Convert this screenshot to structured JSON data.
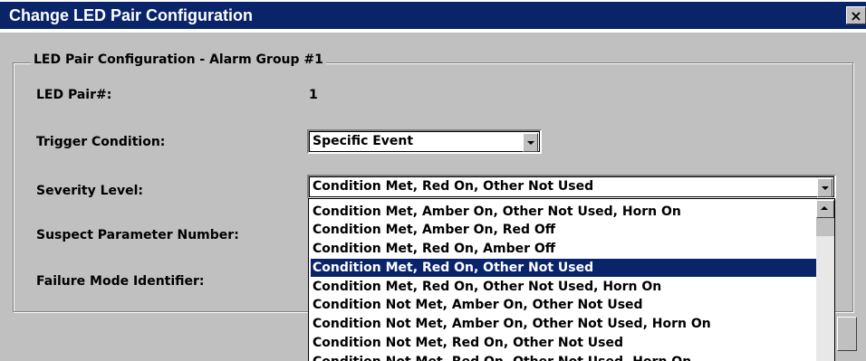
{
  "window": {
    "title": "Change LED Pair Configuration",
    "close_label": "×"
  },
  "group": {
    "title": "LED Pair Configuration - Alarm Group #1"
  },
  "fields": {
    "led_pair_label": "LED Pair#:",
    "led_pair_value": "1",
    "trigger_label": "Trigger Condition:",
    "trigger_value": "Specific Event",
    "severity_label": "Severity Level:",
    "severity_value": "Condition Met, Red On, Other Not Used",
    "spn_label": "Suspect Parameter Number:",
    "fmi_label": "Failure Mode Identifier:"
  },
  "severity_options": [
    "Condition Met, Amber On, Other Not Used, Horn On",
    "Condition Met, Amber On, Red Off",
    "Condition Met, Red On, Amber Off",
    "Condition Met, Red On, Other Not Used",
    "Condition Met, Red On, Other Not Used, Horn On",
    "Condition Not Met, Amber On, Other Not Used",
    "Condition Not Met, Amber On, Other Not Used, Horn On",
    "Condition Not Met, Red On, Other Not Used",
    "Condition Not Met, Red On, Other Not Used, Horn On"
  ],
  "selected_index": 3,
  "colors": {
    "titlebar": "#0a246a",
    "selection": "#0a246a",
    "face": "#c0c0c0"
  }
}
